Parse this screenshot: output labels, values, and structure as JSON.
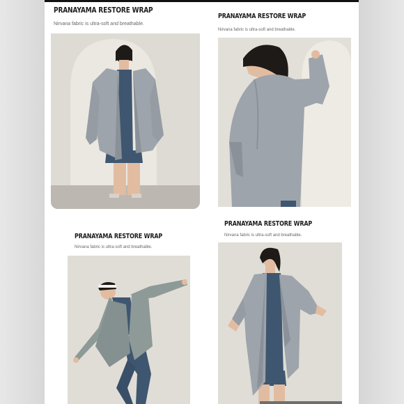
{
  "products": [
    {
      "title": "PRANAYAMA RESTORE WRAP",
      "subtitle": "Nirvana fabric is ultra-soft and breathable.",
      "image_alt": "Model in grey wrap cardigan, front view"
    },
    {
      "title": "PRANAYAMA RESTORE WRAP",
      "subtitle": "Nirvana fabric is ultra-soft and breathable.",
      "image_alt": "Model in grey wrap cardigan, back view"
    },
    {
      "title": "PRANAYAMA RESTORE WRAP",
      "subtitle": "Nirvana fabric is ultra-soft and breathable.",
      "image_alt": "Model in green-grey wrap cardigan, stretching"
    },
    {
      "title": "PRANAYAMA RESTORE WRAP",
      "subtitle": "Nirvana fabric is ultra-soft and breathable.",
      "image_alt": "Model in grey wrap cardigan, hands on hips"
    }
  ],
  "colors": {
    "wrap_grey": "#9ea4ab",
    "wrap_green": "#8e9a97",
    "navy": "#3f5670",
    "backdrop": "#e4e1db"
  }
}
